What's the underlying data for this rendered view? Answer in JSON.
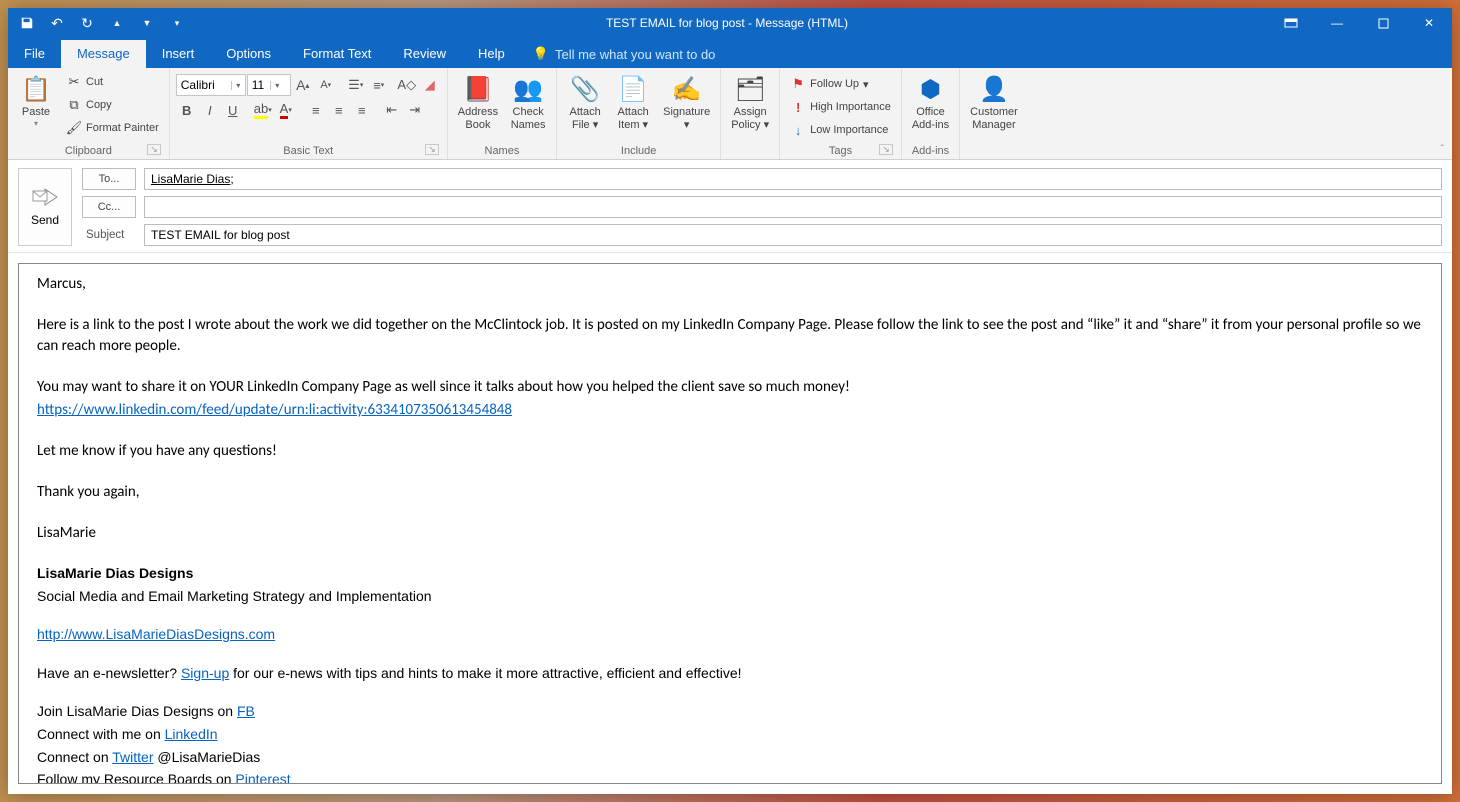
{
  "window": {
    "title": "TEST EMAIL for blog post  -  Message (HTML)"
  },
  "tabs": {
    "file": "File",
    "message": "Message",
    "insert": "Insert",
    "options": "Options",
    "format": "Format Text",
    "review": "Review",
    "help": "Help",
    "tellme": "Tell me what you want to do"
  },
  "ribbon": {
    "clipboard": {
      "label": "Clipboard",
      "paste": "Paste",
      "cut": "Cut",
      "copy": "Copy",
      "painter": "Format Painter"
    },
    "font": {
      "label": "Basic Text",
      "name": "Calibri",
      "size": "11"
    },
    "names": {
      "label": "Names",
      "addr": "Address Book",
      "check": "Check Names"
    },
    "include": {
      "label": "Include",
      "file": "Attach File",
      "item": "Attach Item",
      "sig": "Signature"
    },
    "assign": {
      "label": "Assign Policy"
    },
    "tags": {
      "label": "Tags",
      "follow": "Follow Up",
      "high": "High Importance",
      "low": "Low Importance"
    },
    "addins": {
      "label": "Add-ins",
      "office": "Office Add-ins",
      "cust": "Customer Manager"
    }
  },
  "header": {
    "send": "Send",
    "to_btn": "To...",
    "to_val": "LisaMarie Dias",
    "cc_btn": "Cc...",
    "cc_val": "",
    "subject_lbl": "Subject",
    "subject_val": "TEST EMAIL for blog post"
  },
  "body": {
    "p1": "Marcus,",
    "p2": "Here is a link to the post I wrote about the work we did together on the McClintock job. It is posted on my LinkedIn Company Page. Please follow the link to see the post and “like” it and “share” it from your personal profile so we can reach more people.",
    "p3": "You may want to share it on YOUR LinkedIn Company Page as well since it talks about how you helped the client save so much money!",
    "link1": "https://www.linkedin.com/feed/update/urn:li:activity:6334107350613454848",
    "p4": "Let me know if you have any questions!",
    "p5": "Thank you again,",
    "p6": "LisaMarie",
    "sig": {
      "name": "LisaMarie Dias Designs",
      "tag": "Social Media and Email Marketing Strategy and Implementation",
      "site": "http://www.LisaMarieDiasDesigns.com",
      "enews_pre": "Have an e-newsletter? ",
      "enews_link": "Sign-up",
      "enews_post": " for our e-news with tips and hints to make it more attractive, efficient and effective!",
      "fb_pre": "Join LisaMarie Dias Designs on ",
      "fb_link": "FB",
      "li_pre": "Connect with me on ",
      "li_link": "LinkedIn",
      "tw_pre": "Connect on ",
      "tw_link": "Twitter",
      "tw_post": " @LisaMarieDias",
      "pin_pre": "Follow my Resource Boards on ",
      "pin_link": "Pinterest"
    }
  }
}
